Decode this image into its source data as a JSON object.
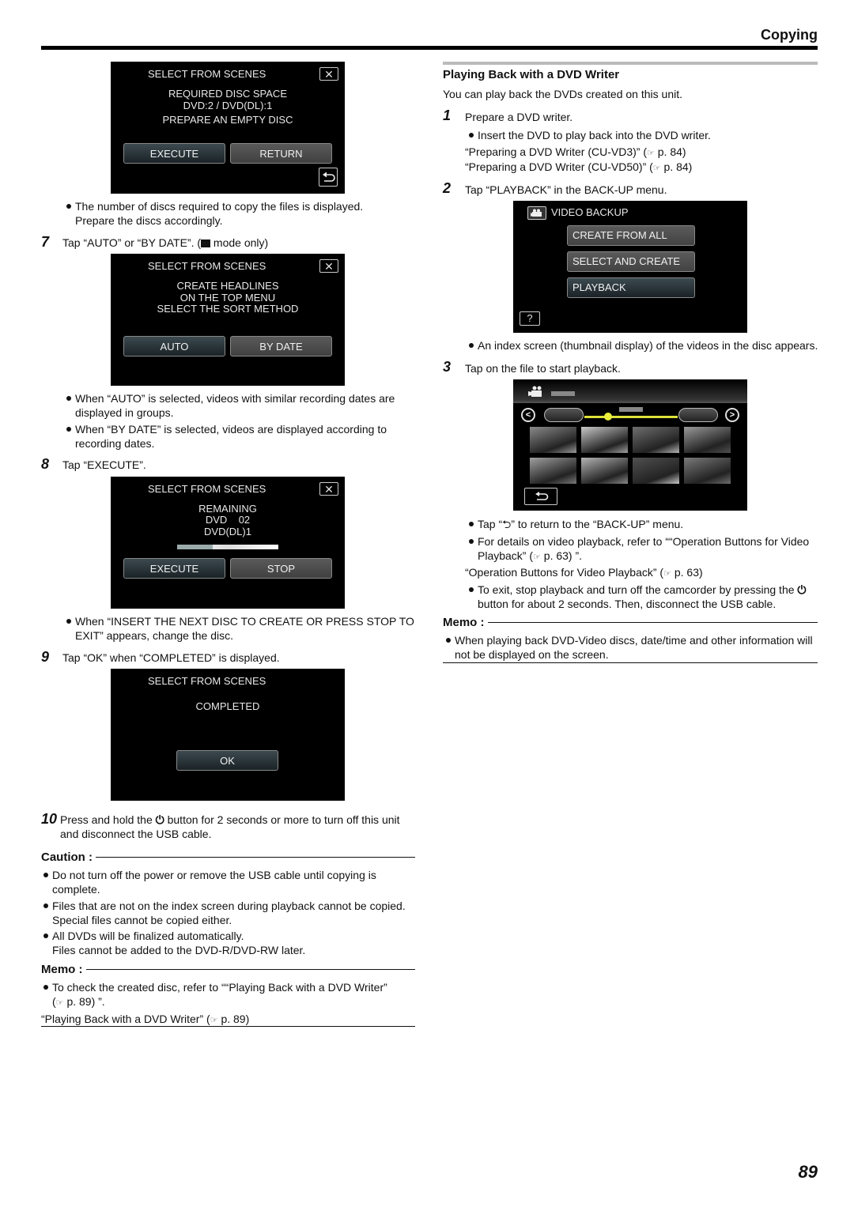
{
  "header": {
    "section_title": "Copying"
  },
  "page_number": "89",
  "left": {
    "screen1": {
      "title": "SELECT FROM SCENES",
      "lines": [
        "REQUIRED DISC SPACE",
        "DVD:2 / DVD(DL):1",
        "PREPARE AN EMPTY DISC"
      ],
      "buttons": [
        "EXECUTE",
        "RETURN"
      ],
      "close_icon": "close-x-icon",
      "back_icon": "return-arrow-icon"
    },
    "note_discs": [
      "The number of discs required to copy the files is displayed.",
      "Prepare the discs accordingly."
    ],
    "step7": {
      "num": "7",
      "text_before": "Tap “AUTO” or “BY DATE”. (",
      "icon": "video-camera-icon",
      "text_after": " mode only)"
    },
    "screen2": {
      "title": "SELECT FROM SCENES",
      "lines": [
        "CREATE HEADLINES",
        "ON THE TOP MENU",
        "SELECT THE SORT METHOD"
      ],
      "buttons": [
        "AUTO",
        "BY DATE"
      ]
    },
    "bullets_sort": [
      [
        "When “AUTO” is selected, videos with similar recording dates are",
        "displayed in groups."
      ],
      [
        "When “BY DATE” is selected, videos are displayed according to",
        "recording dates."
      ]
    ],
    "step8": {
      "num": "8",
      "text": "Tap “EXECUTE”."
    },
    "screen3": {
      "title": "SELECT FROM SCENES",
      "lines": [
        "REMAINING",
        "DVD    02",
        "DVD(DL)1"
      ],
      "progress_percent": 35,
      "buttons": [
        "EXECUTE",
        "STOP"
      ]
    },
    "bullet_insert": [
      "When “INSERT THE NEXT DISC TO CREATE OR PRESS STOP TO",
      "EXIT” appears, change the disc."
    ],
    "step9": {
      "num": "9",
      "text": "Tap “OK” when “COMPLETED” is displayed."
    },
    "screen4": {
      "title": "SELECT FROM SCENES",
      "lines": [
        "COMPLETED"
      ],
      "buttons": [
        "OK"
      ]
    },
    "step10": {
      "num": "10",
      "line1_before": "Press and hold the ",
      "line1_after": " button for 2 seconds or more to turn off this unit",
      "line2": "and disconnect the USB cable."
    },
    "caution": {
      "heading": "Caution :",
      "items": [
        [
          "Do not turn off the power or remove the USB cable until copying is",
          "complete."
        ],
        [
          "Files that are not on the index screen during playback cannot be copied.",
          "Special files cannot be copied either."
        ],
        [
          "All DVDs will be finalized automatically.",
          "Files cannot be added to the DVD-R/DVD-RW later."
        ]
      ]
    },
    "memo": {
      "heading": "Memo :",
      "item": [
        "To check the created disc, refer to ““Playing Back with a DVD Writer”",
        "p. 89) ”."
      ],
      "link": "“Playing Back with a DVD Writer” (",
      "link_page": "p. 89)"
    }
  },
  "right": {
    "title": "Playing Back with a DVD Writer",
    "intro": "You can play back the DVDs created on this unit.",
    "step1": {
      "num": "1",
      "text": "Prepare a DVD writer.",
      "bullet": "Insert the DVD to play back into the DVD writer.",
      "links": [
        {
          "text": "“Preparing a DVD Writer (CU-VD3)” (",
          "page": "p. 84)"
        },
        {
          "text": "“Preparing a DVD Writer (CU-VD50)” (",
          "page": "p. 84)"
        }
      ]
    },
    "step2": {
      "num": "2",
      "text": "Tap “PLAYBACK” in the BACK-UP menu."
    },
    "menu_screen": {
      "title": "VIDEO BACKUP",
      "items": [
        "CREATE FROM ALL",
        "SELECT AND CREATE",
        "PLAYBACK"
      ],
      "help": "?"
    },
    "bullet_index": "An index screen (thumbnail display) of the videos in the disc appears.",
    "step3": {
      "num": "3",
      "text": "Tap on the file to start playback."
    },
    "index_screen": {
      "thumbnail_count": 8
    },
    "bullets_after": {
      "tap_back_before": "Tap “",
      "tap_back_after": "” to return to the “BACK-UP” menu.",
      "details": [
        "For details on video playback, refer to ““Operation Buttons for Video",
        "Playback” (",
        "p. 63) ”."
      ],
      "link": "“Operation Buttons for Video Playback” (",
      "link_page": "p. 63)",
      "exit_line1": "To exit, stop playback and turn off the camcorder by pressing the ",
      "exit_line2": "button for about 2 seconds. Then, disconnect the USB cable."
    },
    "memo": {
      "heading": "Memo :",
      "item": [
        "When playing back DVD-Video discs, date/time and other information will",
        "not be displayed on the screen."
      ]
    }
  },
  "icons": {
    "ref": "☞",
    "power": "⏻"
  }
}
